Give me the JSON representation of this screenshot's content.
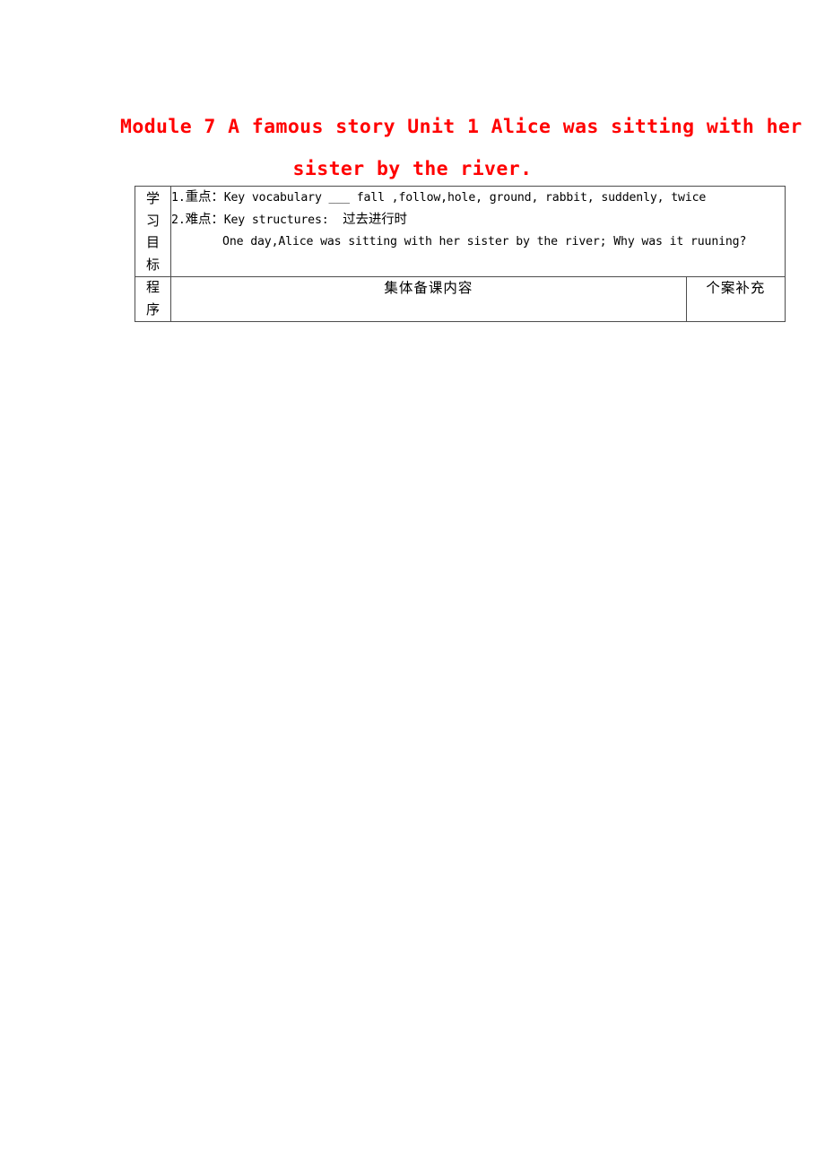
{
  "document": {
    "title": {
      "line1": "Module 7 A famous story  Unit 1  Alice was sitting with her",
      "line2": "sister by the river.",
      "color": "#ff0000"
    },
    "table": {
      "rows": [
        {
          "label": "学习目标",
          "label_chars": [
            "学",
            "习",
            "目",
            "标"
          ],
          "content_lines": [
            "1.重点：Key vocabulary ___ fall ,follow,hole, ground, rabbit, suddenly, twice",
            "2.难点：Key structures:  过去进行时",
            "One day,Alice was sitting with her sister by the river; Why was it ruuning?"
          ],
          "line1_prefix": "1.",
          "line1_cjk": "重点：",
          "line1_rest": "Key vocabulary ___ fall ,follow,hole, ground, rabbit, suddenly, twice",
          "line2_prefix": "2.",
          "line2_cjk": "难点：",
          "line2_rest_en": "Key structures:  ",
          "line2_rest_cjk": "过去进行时",
          "line3": "One day,Alice was sitting with her sister by the river; Why was it ruuning?"
        },
        {
          "label": "程序",
          "label_chars": [
            "程",
            "序"
          ],
          "collective": "集体备课内容",
          "individual": "个案补充"
        }
      ]
    }
  }
}
